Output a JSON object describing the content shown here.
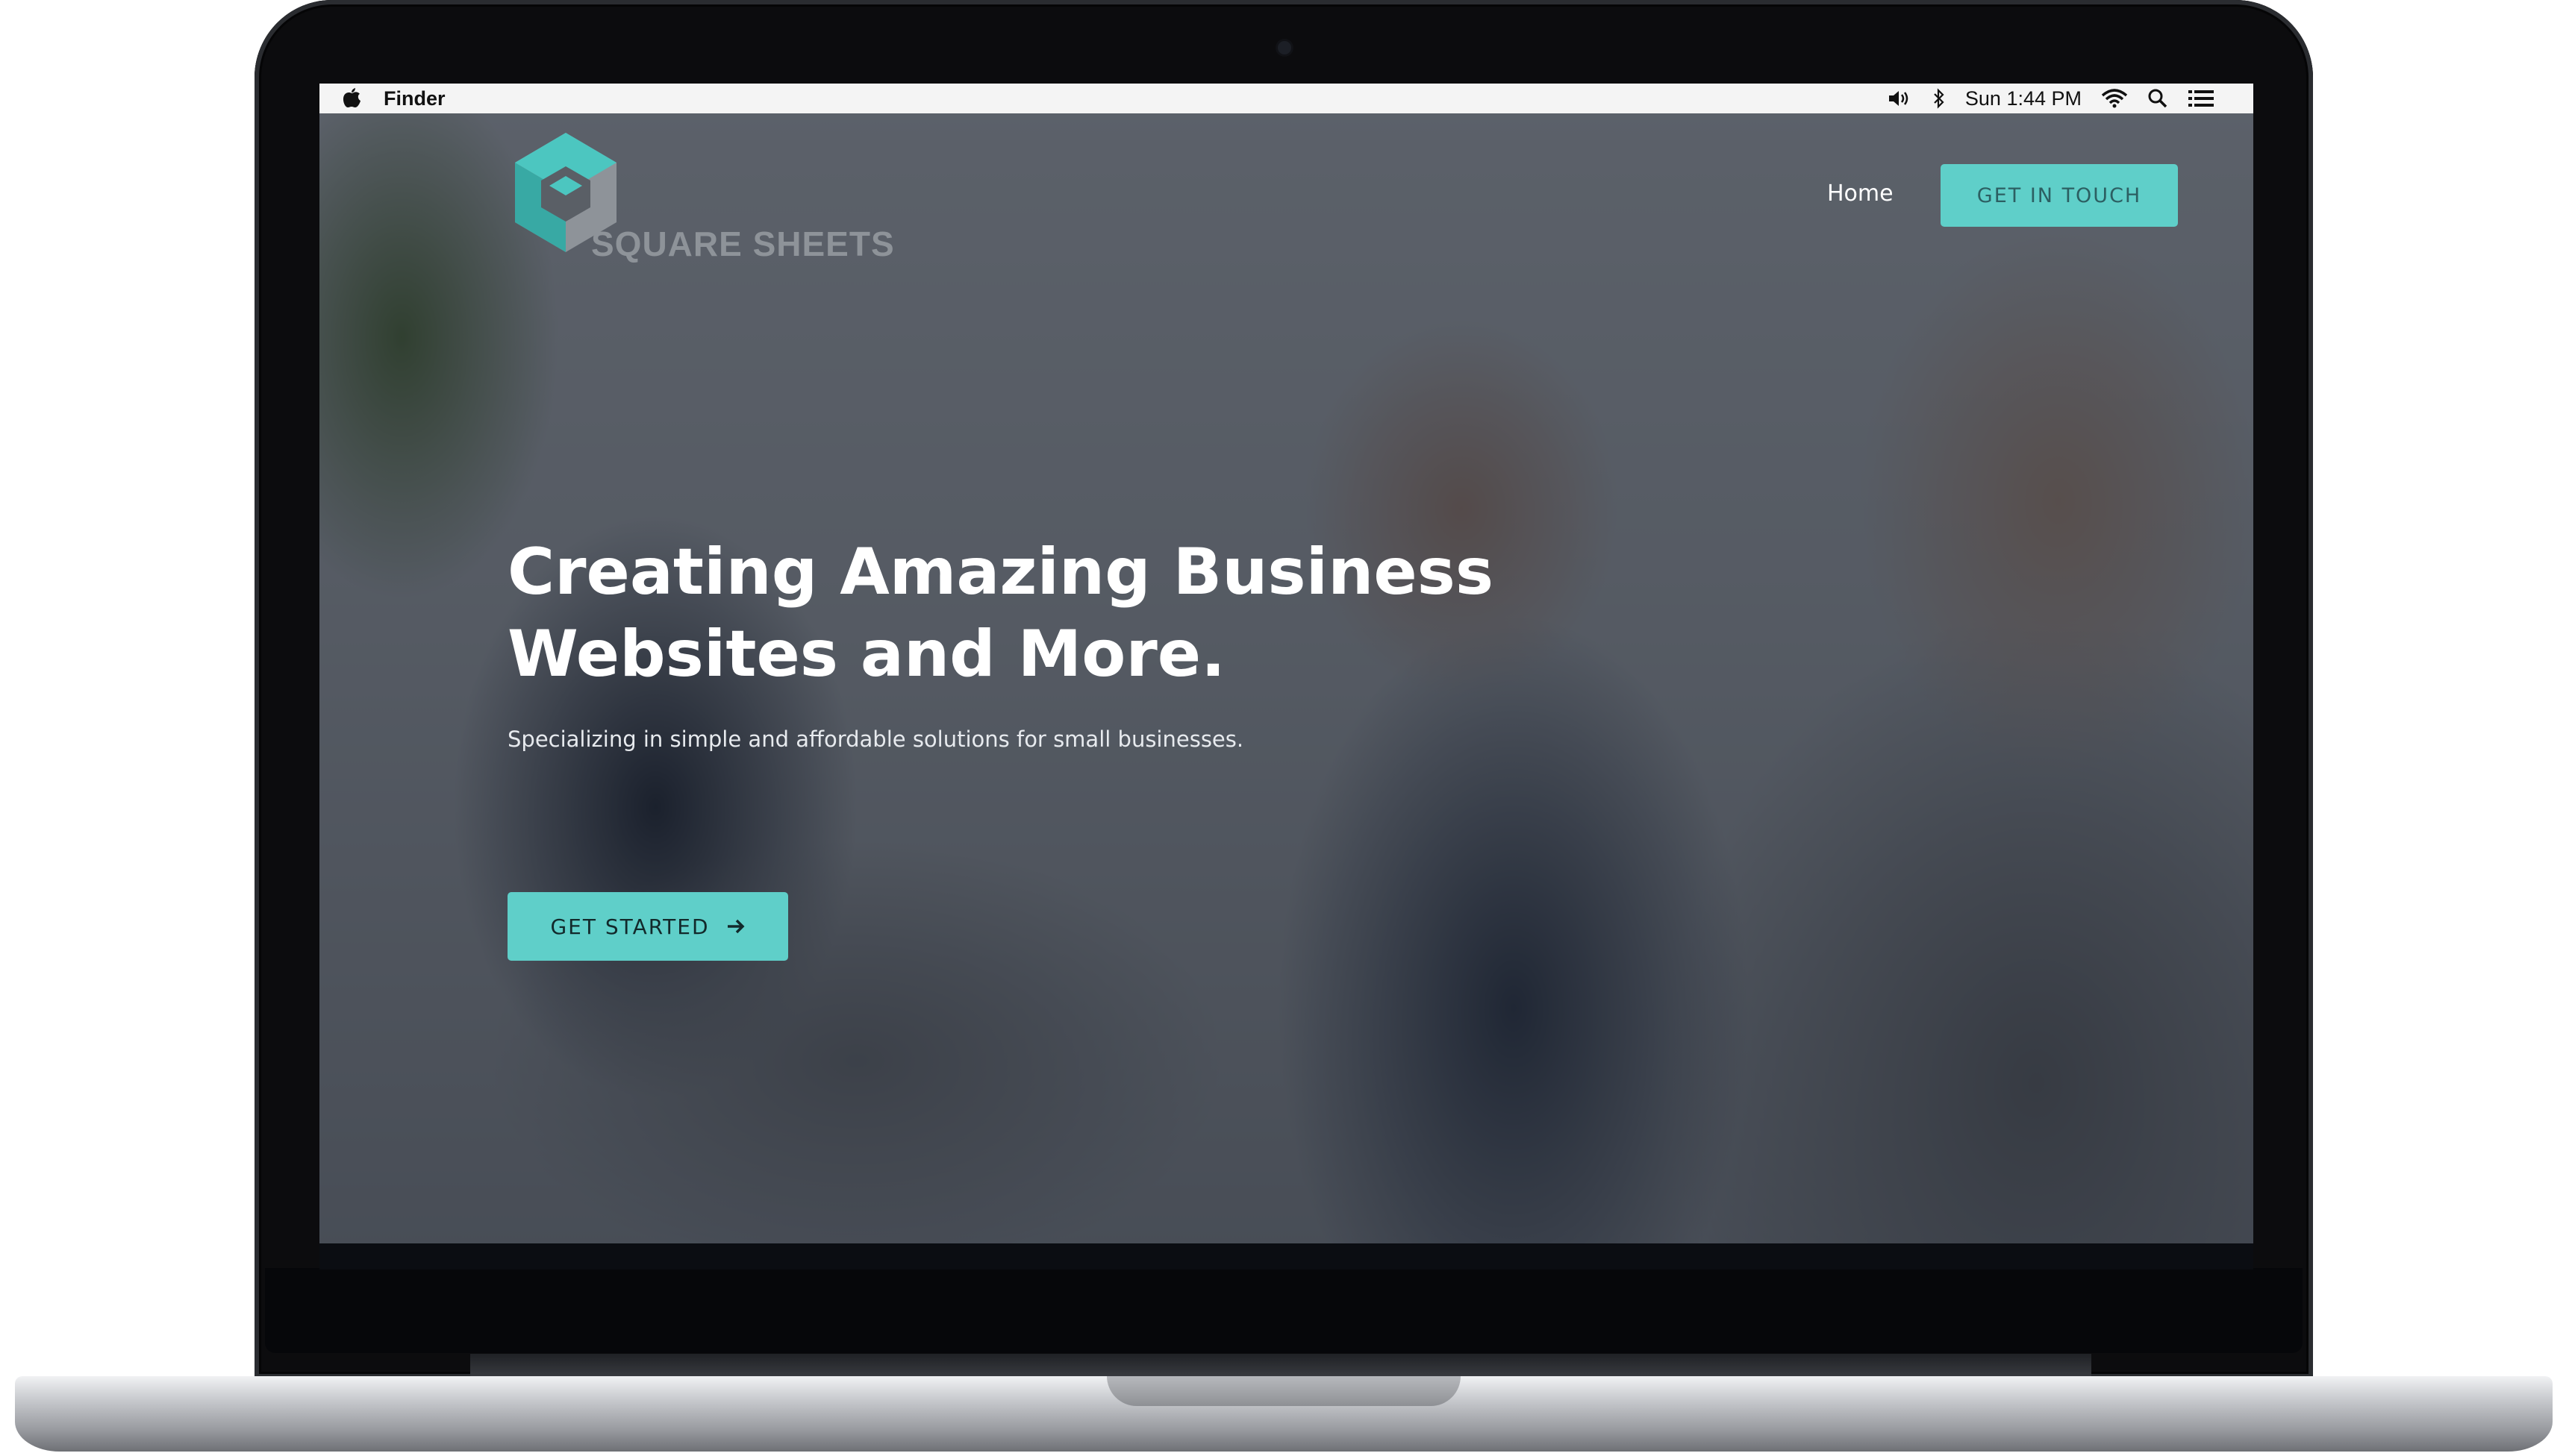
{
  "menubar": {
    "app_name": "Finder",
    "clock": "Sun 1:44 PM",
    "icons": [
      "apple-icon",
      "volume-icon",
      "bluetooth-icon",
      "wifi-icon",
      "spotlight-search-icon",
      "notification-list-icon"
    ]
  },
  "site": {
    "logo_text": "SQUARE SHEETS",
    "nav": {
      "home": "Home"
    },
    "top_cta": "GET IN TOUCH",
    "hero": {
      "title_line1": "Creating Amazing Business",
      "title_line2": "Websites and More.",
      "subtitle": "Specializing in simple and affordable solutions for small businesses.",
      "cta": "GET STARTED",
      "cta_icon": "arrow-right-icon"
    }
  },
  "colors": {
    "accent": "#5fcfc9",
    "logo_teal": "#4cc6c0",
    "logo_gray": "#8e9399",
    "overlay": "#1c222c"
  }
}
